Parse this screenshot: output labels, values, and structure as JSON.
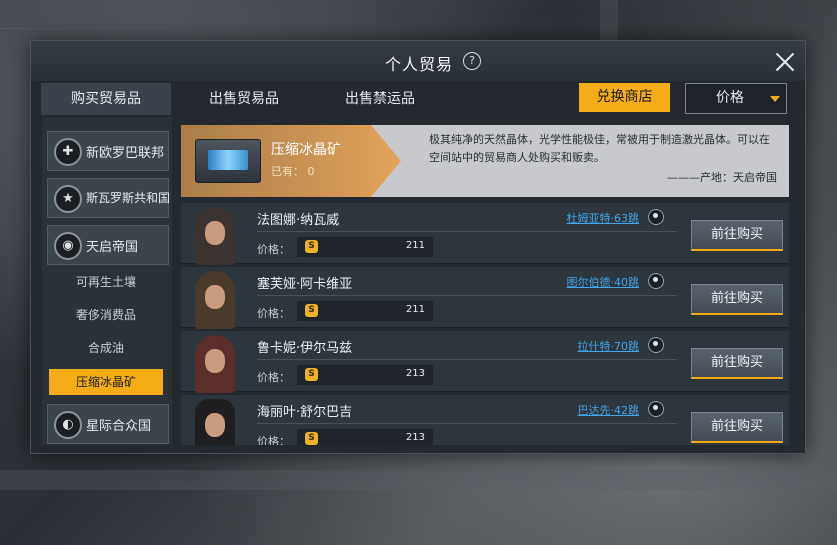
{
  "window": {
    "title": "个人贸易",
    "help_glyph": "?"
  },
  "tabs": [
    {
      "label": "购买贸易品",
      "active": true
    },
    {
      "label": "出售贸易品",
      "active": false
    },
    {
      "label": "出售禁运品",
      "active": false
    }
  ],
  "toolbar": {
    "shop_label": "兑换商店",
    "sort_label": "价格"
  },
  "sidebar": {
    "factions": [
      {
        "name": "新欧罗巴联邦",
        "emblem": "✚",
        "icon": "cross-emblem-icon"
      },
      {
        "name": "斯瓦罗斯共和国",
        "emblem": "★",
        "icon": "star-emblem-icon"
      },
      {
        "name": "天启帝国",
        "emblem": "◉",
        "icon": "eagle-emblem-icon"
      },
      {
        "name": "星际合众国",
        "emblem": "◐",
        "icon": "swirl-emblem-icon"
      }
    ],
    "subitems": [
      {
        "label": "可再生土壤",
        "selected": false
      },
      {
        "label": "奢侈消费品",
        "selected": false
      },
      {
        "label": "合成油",
        "selected": false
      },
      {
        "label": "压缩冰晶矿",
        "selected": true
      }
    ]
  },
  "item": {
    "name": "压缩冰晶矿",
    "owned": "已有：  0",
    "description": "极其纯净的天然晶体，光学性能极佳，常被用于制造激光晶体。可以在空间站中的贸易商人处购买和贩卖。",
    "origin": "———产地：天启帝国"
  },
  "traders": [
    {
      "name": "法图娜·纳瓦威",
      "location": "杜姆亚特·63跳",
      "price_label": "价格：",
      "price": "211",
      "buy_label": "前往购买"
    },
    {
      "name": "塞芙娅·阿卡维亚",
      "location": "图尔伯德·40跳",
      "price_label": "价格：",
      "price": "211",
      "buy_label": "前往购买"
    },
    {
      "name": "鲁卡妮·伊尔马兹",
      "location": "拉什特·70跳",
      "price_label": "价格：",
      "price": "213",
      "buy_label": "前往购买"
    },
    {
      "name": "海丽叶·舒尔巴吉",
      "location": "巴达先·42跳",
      "price_label": "价格：",
      "price": "213",
      "buy_label": "前往购买"
    }
  ],
  "currency_glyph": "S",
  "colors": {
    "accent": "#f4ad16",
    "link": "#43a6ea",
    "panel": "#23292f"
  }
}
